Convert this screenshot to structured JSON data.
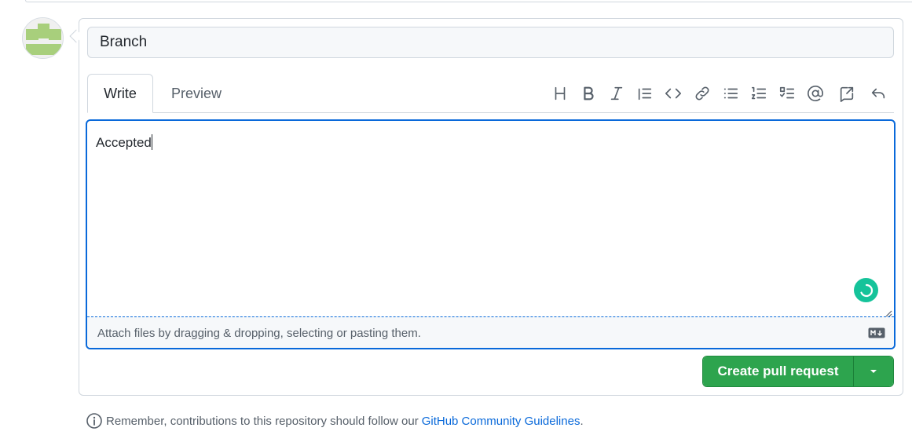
{
  "form": {
    "title_value": "Branch",
    "tabs": [
      {
        "label": "Write",
        "active": true
      },
      {
        "label": "Preview",
        "active": false
      }
    ],
    "toolbar": [
      {
        "name": "heading-icon"
      },
      {
        "name": "bold-icon"
      },
      {
        "name": "italic-icon"
      },
      {
        "name": "quote-icon"
      },
      {
        "name": "code-icon"
      },
      {
        "name": "link-icon"
      },
      {
        "name": "unordered-list-icon"
      },
      {
        "name": "ordered-list-icon"
      },
      {
        "name": "task-list-icon"
      },
      {
        "name": "mention-icon"
      },
      {
        "name": "cross-reference-icon"
      },
      {
        "name": "reply-icon"
      }
    ],
    "body_value": "Accepted",
    "attach_hint": "Attach files by dragging & dropping, selecting or pasting them."
  },
  "actions": {
    "create_label": "Create pull request"
  },
  "notice": {
    "text": "Remember, contributions to this repository should follow our",
    "link": "GitHub Community Guidelines",
    "period": "."
  },
  "colors": {
    "accent": "#0969da",
    "primary_button": "#2da44e",
    "grammarly": "#15c39a",
    "avatar": "#a8cf7c"
  }
}
